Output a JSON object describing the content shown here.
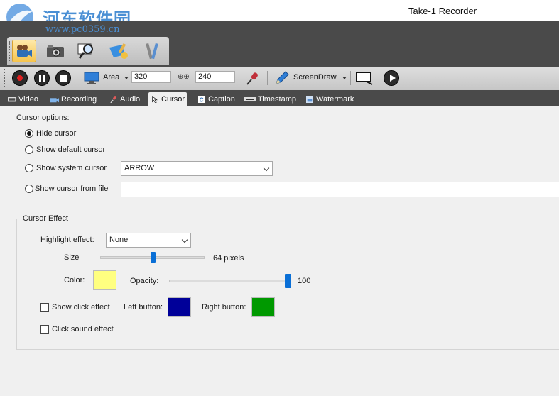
{
  "watermark": {
    "text": "河东软件园",
    "url": "www.pc0359.cn"
  },
  "window": {
    "title": "Take-1 Recorder"
  },
  "mode_tabs": [
    {
      "icon": "camcorder-icon",
      "active": true
    },
    {
      "icon": "camera-icon",
      "active": false
    },
    {
      "icon": "magnifier-icon",
      "active": false
    },
    {
      "icon": "brush-icon",
      "active": false
    },
    {
      "icon": "tools-icon",
      "active": false
    }
  ],
  "toolbar": {
    "area_label": "Area",
    "width_value": "320",
    "height_value": "240",
    "screendraw_label": "ScreenDraw"
  },
  "tabs": [
    {
      "label": "Video",
      "icon": "film-icon"
    },
    {
      "label": "Recording",
      "icon": "recording-icon"
    },
    {
      "label": "Audio",
      "icon": "audio-icon"
    },
    {
      "label": "Cursor",
      "icon": "cursor-icon",
      "active": true
    },
    {
      "label": "Caption",
      "icon": "caption-icon"
    },
    {
      "label": "Timestamp",
      "icon": "timestamp-icon"
    },
    {
      "label": "Watermark",
      "icon": "watermark-icon"
    }
  ],
  "cursor_options": {
    "title": "Cursor options:",
    "hide_label": "Hide cursor",
    "default_label": "Show default cursor",
    "system_label": "Show system cursor",
    "system_value": "ARROW",
    "file_label": "Show cursor from file",
    "file_value": "",
    "selected": "hide"
  },
  "cursor_effect": {
    "title": "Cursor Effect",
    "highlight_label": "Highlight effect:",
    "highlight_value": "None",
    "size_label": "Size",
    "size_value": "64 pixels",
    "size_fraction": 0.5,
    "color_label": "Color:",
    "highlight_color": "#ffff80",
    "opacity_label": "Opacity:",
    "opacity_value": "100",
    "click_effect_label": "Show click effect",
    "click_effect_checked": false,
    "left_button_label": "Left button:",
    "left_button_color": "#000099",
    "right_button_label": "Right button:",
    "right_button_color": "#009900",
    "sound_label": "Click sound effect",
    "sound_checked": false
  },
  "colors": {
    "accent": "#0a6fd6",
    "dark_band": "#4a4a4a"
  }
}
